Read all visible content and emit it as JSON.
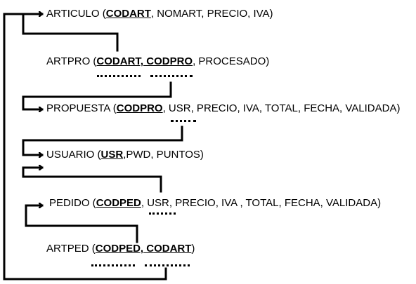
{
  "colors": {
    "ink": "#000000",
    "background": "#ffffff"
  },
  "relations": [
    {
      "id": "articulo",
      "name": "ARTICULO",
      "segments": [
        {
          "text": "ARTICULO (",
          "pk": false
        },
        {
          "text": "CODART",
          "pk": true
        },
        {
          "text": ", NOMART, PRECIO, IVA)",
          "pk": false
        }
      ]
    },
    {
      "id": "artpro",
      "name": "ARTPRO",
      "segments": [
        {
          "text": "ARTPRO (",
          "pk": false
        },
        {
          "text": "CODART, CODPRO",
          "pk": true
        },
        {
          "text": ", PROCESADO)",
          "pk": false
        }
      ]
    },
    {
      "id": "propuesta",
      "name": "PROPUESTA",
      "segments": [
        {
          "text": "PROPUESTA (",
          "pk": false
        },
        {
          "text": "CODPRO",
          "pk": true
        },
        {
          "text": ", USR, PRECIO, IVA, TOTAL, FECHA, VALIDADA)",
          "pk": false
        }
      ]
    },
    {
      "id": "usuario",
      "name": "USUARIO",
      "segments": [
        {
          "text": "USUARIO (",
          "pk": false
        },
        {
          "text": "USR",
          "pk": true
        },
        {
          "text": ",PWD, PUNTOS)",
          "pk": false
        }
      ]
    },
    {
      "id": "pedido",
      "name": "PEDIDO",
      "segments": [
        {
          "text": "PEDIDO (",
          "pk": false
        },
        {
          "text": "CODPED",
          "pk": true
        },
        {
          "text": ", USR, PRECIO, IVA , TOTAL, FECHA, VALIDADA)",
          "pk": false
        }
      ]
    },
    {
      "id": "artped",
      "name": "ARTPED",
      "segments": [
        {
          "text": "ARTPED (",
          "pk": false
        },
        {
          "text": "CODPED, CODART",
          "pk": true
        },
        {
          "text": ")",
          "pk": false
        }
      ]
    }
  ],
  "foreign_keys": [
    {
      "from": "artpro",
      "attribute": "CODART",
      "to": "articulo"
    },
    {
      "from": "artpro",
      "attribute": "CODPRO",
      "to": "propuesta"
    },
    {
      "from": "propuesta",
      "attribute": "USR",
      "to": "usuario"
    },
    {
      "from": "pedido",
      "attribute": "USR",
      "to": "usuario"
    },
    {
      "from": "artped",
      "attribute": "CODPED",
      "to": "pedido"
    },
    {
      "from": "artped",
      "attribute": "CODART",
      "to": "articulo"
    }
  ]
}
